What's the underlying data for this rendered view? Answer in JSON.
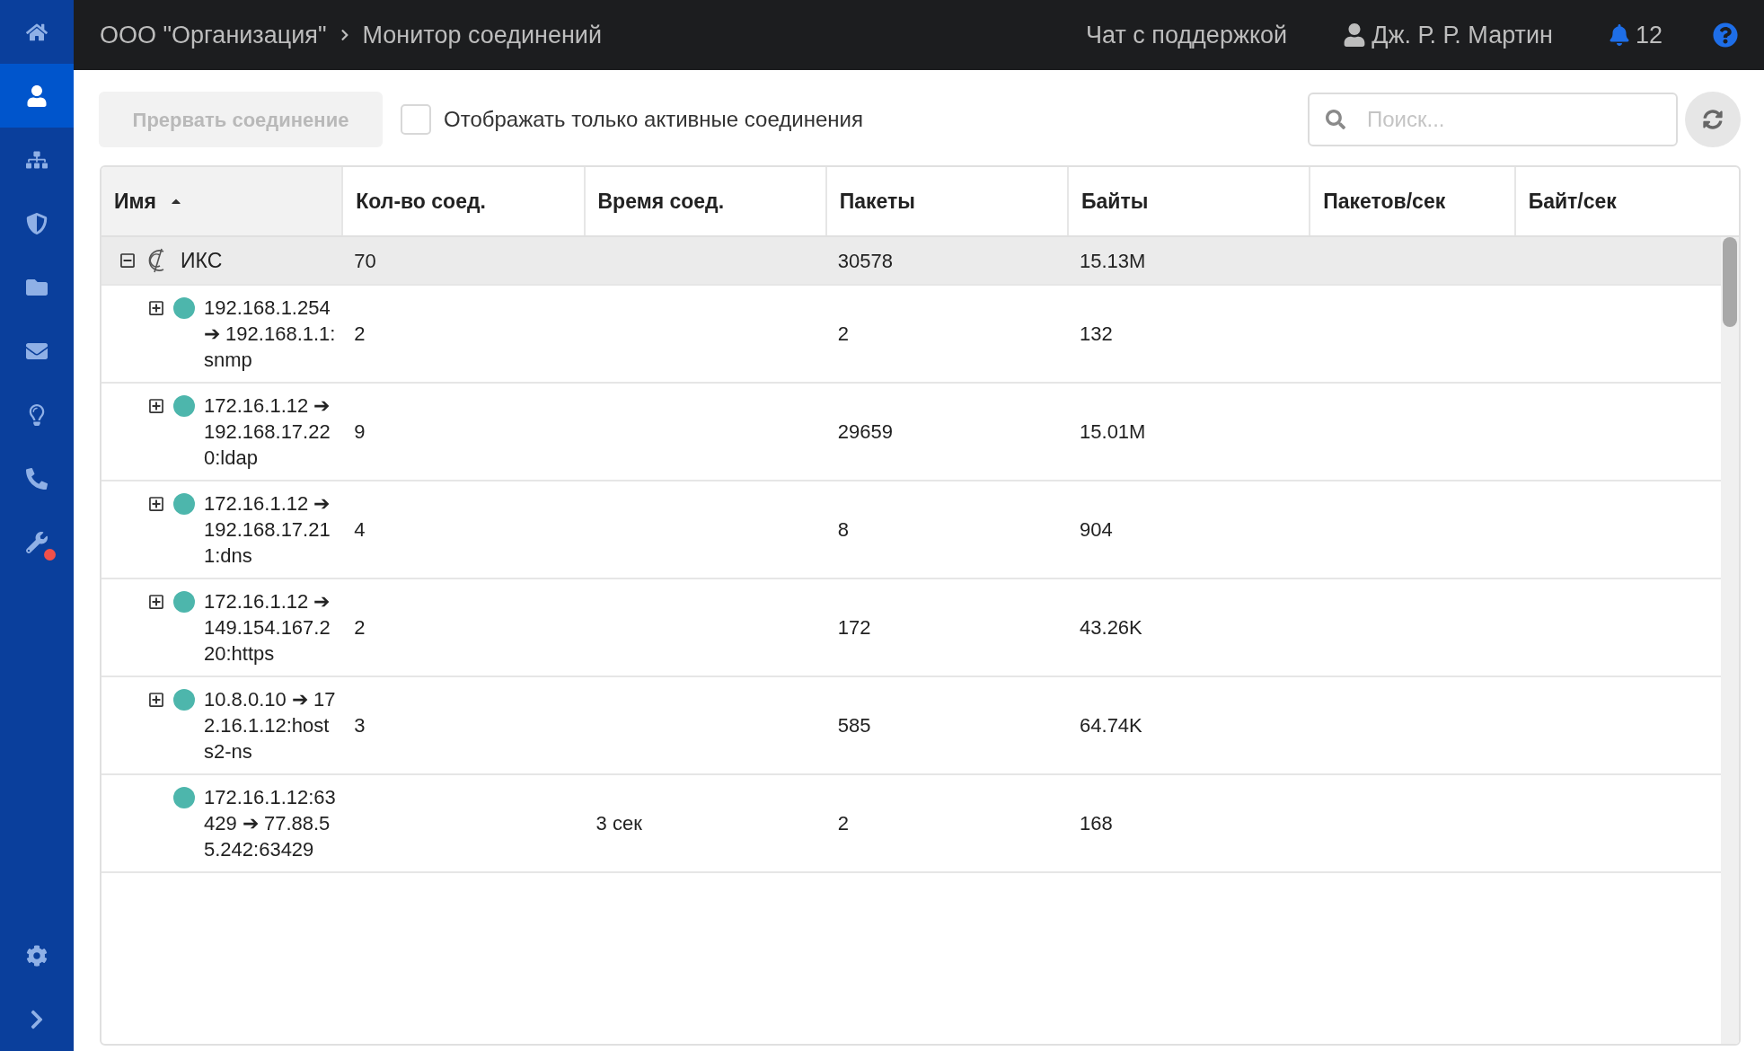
{
  "sidebar": {
    "items": [
      {
        "selected": false,
        "alert": false
      },
      {
        "selected": true,
        "alert": false
      },
      {
        "selected": false,
        "alert": false
      },
      {
        "selected": false,
        "alert": false
      },
      {
        "selected": false,
        "alert": false
      },
      {
        "selected": false,
        "alert": false
      },
      {
        "selected": false,
        "alert": false
      },
      {
        "selected": false,
        "alert": false
      },
      {
        "selected": false,
        "alert": true
      }
    ],
    "bottom_items": [
      {
        "selected": false
      },
      {
        "selected": false
      }
    ]
  },
  "topbar": {
    "breadcrumbs": [
      "ООО \"Организация\"",
      "Монитор соединений"
    ],
    "support_link": "Чат с поддержкой",
    "user": "Дж. Р. Р. Мартин",
    "notifications": "12"
  },
  "toolbar": {
    "terminate_button": {
      "label": "Прервать соединение",
      "disabled": true
    },
    "active_only": {
      "label": "Отображать только активные соединения",
      "checked": false
    },
    "search": {
      "placeholder": "Поиск..."
    }
  },
  "table": {
    "columns": [
      {
        "label": "Имя",
        "sorted": true
      },
      {
        "label": "Кол-во соед.",
        "sorted": false
      },
      {
        "label": "Время соед.",
        "sorted": false
      },
      {
        "label": "Пакеты",
        "sorted": false
      },
      {
        "label": "Байты",
        "sorted": false
      },
      {
        "label": "Пакетов/сек",
        "sorted": false
      },
      {
        "label": "Байт/сек",
        "sorted": false
      }
    ],
    "rows": [
      {
        "name": "ИКС",
        "expanded": true,
        "selected": true,
        "connections": "70",
        "packets": "30578",
        "bytes": "15.13M",
        "children": [
          {
            "name": "192.168.1.254 ➔ 192.168.1.1:snmp",
            "expanded": false,
            "selected": false,
            "color": "#4db6ac",
            "connections": "2",
            "packets": "2",
            "bytes": "132"
          },
          {
            "name": "172.16.1.12 ➔ 192.168.17.220:ldap",
            "expanded": false,
            "selected": false,
            "color": "#4db6ac",
            "connections": "9",
            "packets": "29659",
            "bytes": "15.01M"
          },
          {
            "name": "172.16.1.12 ➔ 192.168.17.211:dns",
            "expanded": false,
            "selected": false,
            "color": "#4db6ac",
            "connections": "4",
            "packets": "8",
            "bytes": "904"
          },
          {
            "name": "172.16.1.12 ➔ 149.154.167.220:https",
            "expanded": false,
            "selected": false,
            "color": "#4db6ac",
            "connections": "2",
            "packets": "172",
            "bytes": "43.26K"
          },
          {
            "name": "10.8.0.10 ➔ 172.16.1.12:hosts2-ns",
            "expanded": false,
            "selected": false,
            "color": "#4db6ac",
            "connections": "3",
            "packets": "585",
            "bytes": "64.74K"
          },
          {
            "name": "172.16.1.12:63429 ➔ 77.88.55.242:63429",
            "selected": false,
            "color": "#4db6ac",
            "time": "3 сек",
            "packets": "2",
            "bytes": "168"
          }
        ]
      }
    ]
  }
}
